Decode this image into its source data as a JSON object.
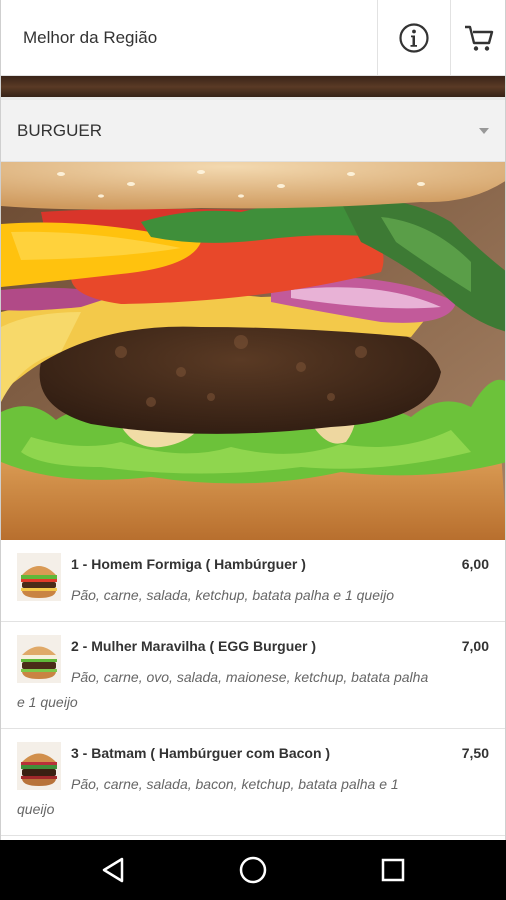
{
  "header": {
    "title": "Melhor da Região",
    "info_icon": "info-icon",
    "cart_icon": "cart-icon"
  },
  "category": {
    "selected": "BURGUER"
  },
  "products": [
    {
      "name": "1 - Homem Formiga ( Hambúrguer )",
      "price": "6,00",
      "description": "Pão, carne, salada, ketchup, batata palha e 1 queijo"
    },
    {
      "name": "2 - Mulher Maravilha ( EGG Burguer )",
      "price": "7,00",
      "description_line1": "Pão, carne, ovo, salada, maionese, ketchup, batata palha",
      "description_line2": "e 1 queijo"
    },
    {
      "name": "3 - Batmam ( Hambúrguer com Bacon )",
      "price": "7,50",
      "description_line1": "Pão, carne, salada, bacon, ketchup, batata palha e 1",
      "description_line2": "queijo"
    }
  ],
  "navbar": {
    "back_icon": "back-triangle-icon",
    "home_icon": "home-circle-icon",
    "recents_icon": "recents-square-icon"
  }
}
